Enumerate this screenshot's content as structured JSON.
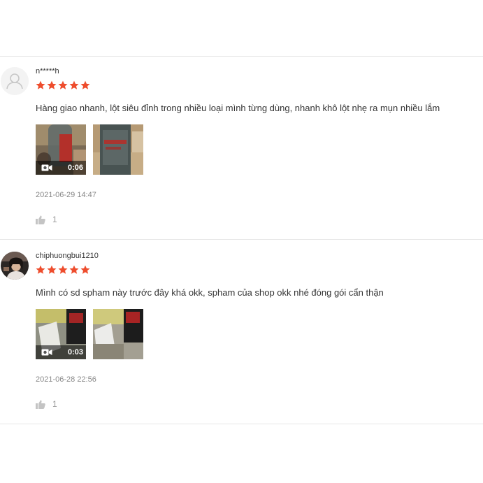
{
  "reviews": [
    {
      "username": "n*****h",
      "avatar": "default-user-icon",
      "rating": 5,
      "comment": "Hàng giao nhanh, lột siêu đỉnh trong nhiều loại mình từng dùng, nhanh khô lột nhẹ ra mụn nhiều lắm",
      "video_duration": "0:06",
      "date": "2021-06-29 14:47",
      "likes": "1"
    },
    {
      "username": "chiphuongbui1210",
      "avatar": "user-photo",
      "rating": 5,
      "comment": "Mình có sd spham này trước đây khá okk, spham của shop okk nhé đóng gói cẩn thận",
      "video_duration": "0:03",
      "date": "2021-06-28 22:56",
      "likes": "1"
    }
  ],
  "colors": {
    "star": "#ee4d2d",
    "divider": "#e6e6e6",
    "date": "#888888"
  }
}
